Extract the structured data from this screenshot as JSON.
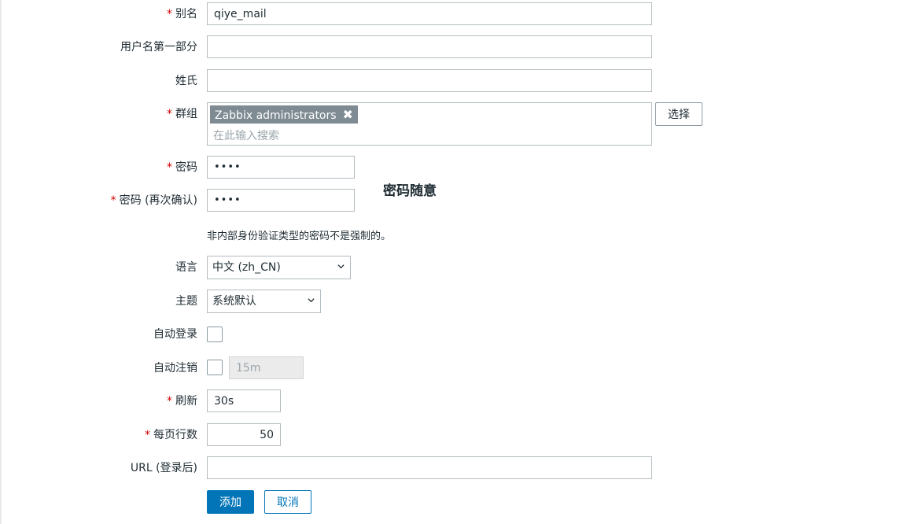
{
  "form": {
    "alias": {
      "label": "别名",
      "value": "qiye_mail"
    },
    "first_name": {
      "label": "用户名第一部分",
      "value": ""
    },
    "surname": {
      "label": "姓氏",
      "value": ""
    },
    "groups": {
      "label": "群组",
      "tags": [
        "Zabbix administrators"
      ],
      "remove_glyph": "✖",
      "search_placeholder": "在此输入搜索",
      "select_button": "选择"
    },
    "password": {
      "label": "密码",
      "value": "••••"
    },
    "password_confirm": {
      "label": "密码 (再次确认)",
      "value": "••••"
    },
    "password_note": "密码随意",
    "password_hint": "非内部身份验证类型的密码不是强制的。",
    "language": {
      "label": "语言",
      "selected": "中文 (zh_CN)"
    },
    "theme": {
      "label": "主题",
      "selected": "系统默认"
    },
    "autologin": {
      "label": "自动登录",
      "checked": false
    },
    "autologout": {
      "label": "自动注销",
      "checked": false,
      "value": "15m"
    },
    "refresh": {
      "label": "刷新",
      "value": "30s"
    },
    "rows_per_page": {
      "label": "每页行数",
      "value": "50"
    },
    "url": {
      "label": "URL (登录后)",
      "value": ""
    },
    "required_mark": "*",
    "buttons": {
      "add": "添加",
      "cancel": "取消"
    }
  },
  "colors": {
    "primary": "#0275b8",
    "required": "#d40000",
    "tag_bg": "#7e8b93",
    "border": "#b3bcc1"
  }
}
